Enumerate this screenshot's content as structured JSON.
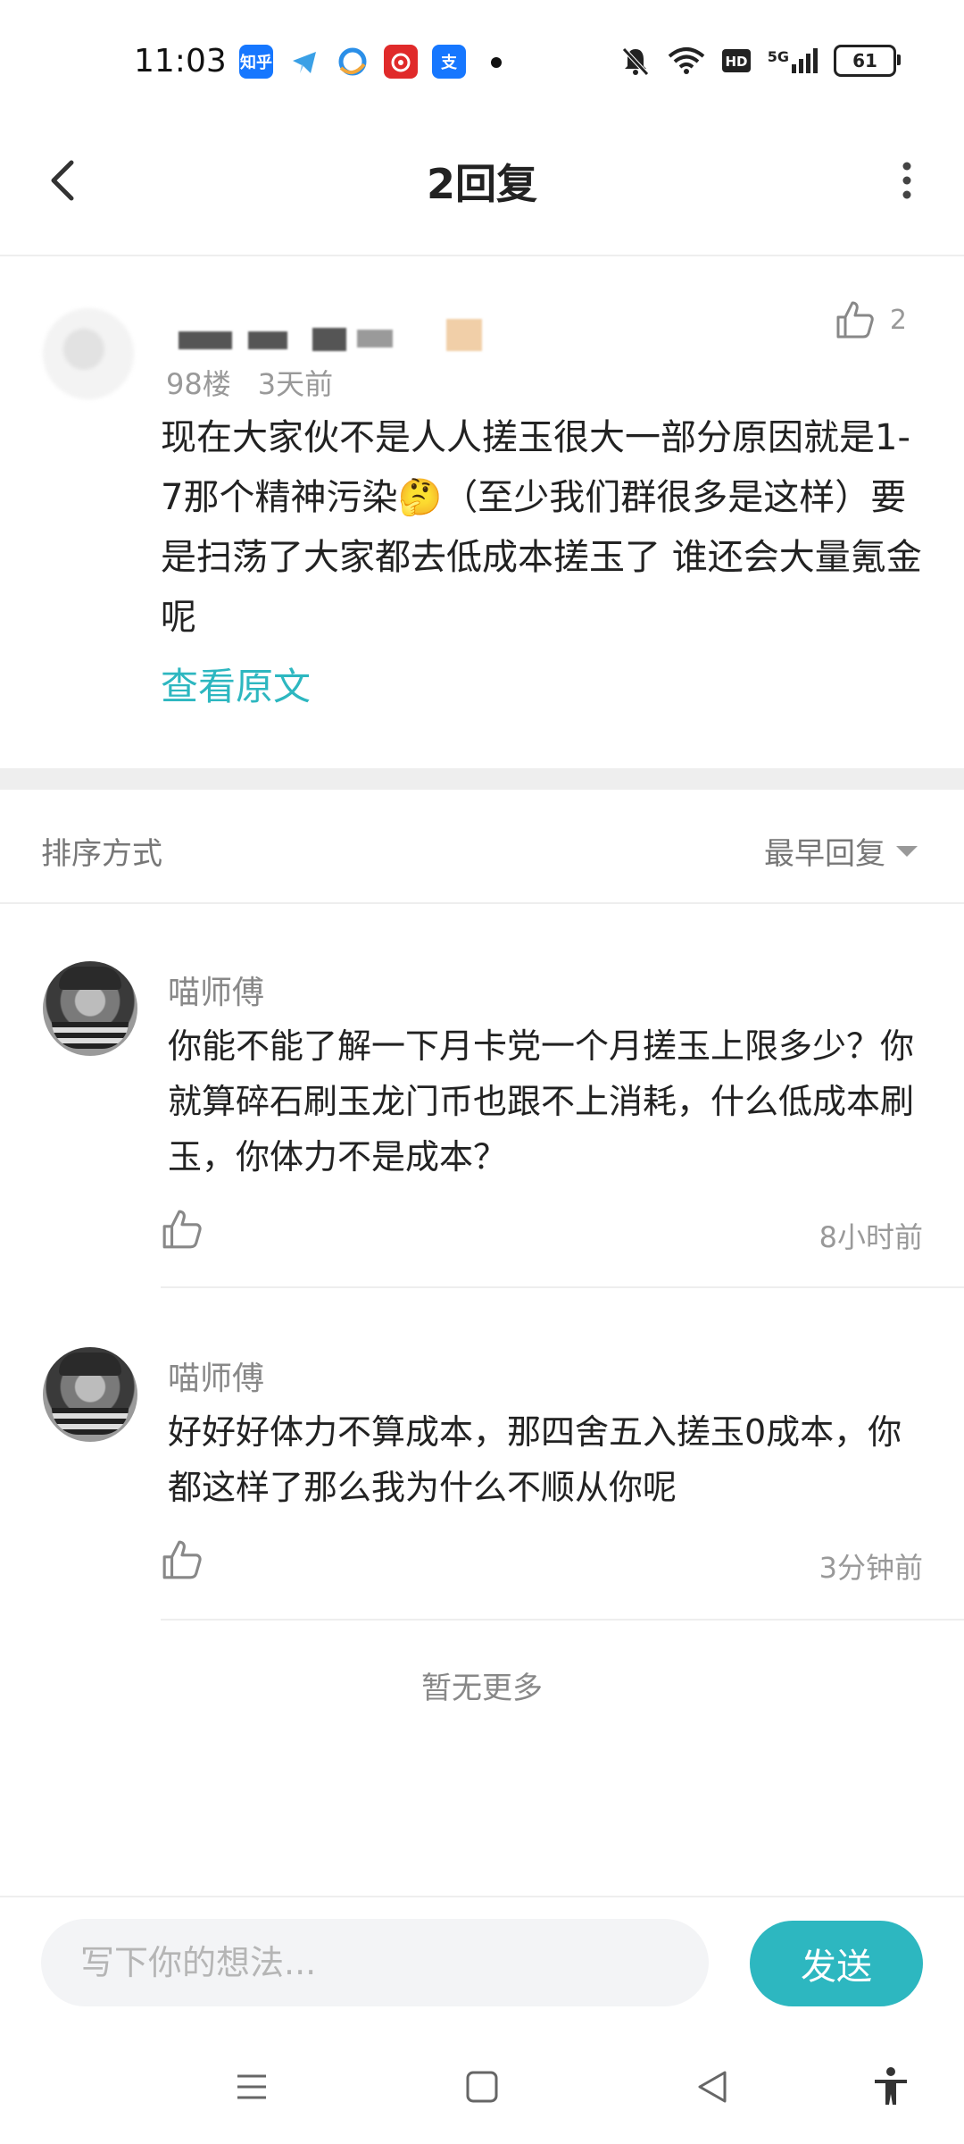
{
  "status_bar": {
    "time": "11:03",
    "apps": [
      {
        "icon": "zhihu-icon",
        "label": "知乎",
        "color": "#1677ff"
      },
      {
        "icon": "telegram-icon",
        "label": "",
        "color": "#3aa0e6"
      },
      {
        "icon": "qq-browser-icon",
        "label": "",
        "color": "#2b8fe8"
      },
      {
        "icon": "netease-music-icon",
        "label": "",
        "color": "#e02a2a"
      },
      {
        "icon": "alipay-icon",
        "label": "支",
        "color": "#1677ff"
      }
    ],
    "network": "5G",
    "battery": "61"
  },
  "header": {
    "title": "2回复"
  },
  "post": {
    "floor": "98楼",
    "time": "3天前",
    "like_count": "2",
    "body": "现在大家伙不是人人搓玉很大一部分原因就是1-7那个精神污染🤔（至少我们群很多是这样）要是扫荡了大家都去低成本搓玉了 谁还会大量氪金呢",
    "view_original": "查看原文"
  },
  "sort": {
    "label": "排序方式",
    "value": "最早回复"
  },
  "replies": [
    {
      "name": "喵师傅",
      "text": "你能不能了解一下月卡党一个月搓玉上限多少？你就算碎石刷玉龙门币也跟不上消耗，什么低成本刷玉，你体力不是成本？",
      "time": "8小时前"
    },
    {
      "name": "喵师傅",
      "text": "好好好体力不算成本，那四舍五入搓玉0成本，你都这样了那么我为什么不顺从你呢",
      "time": "3分钟前"
    }
  ],
  "no_more": "暂无更多",
  "input": {
    "placeholder": "写下你的想法...",
    "send_label": "发送"
  },
  "colors": {
    "accent": "#2db7c0"
  }
}
